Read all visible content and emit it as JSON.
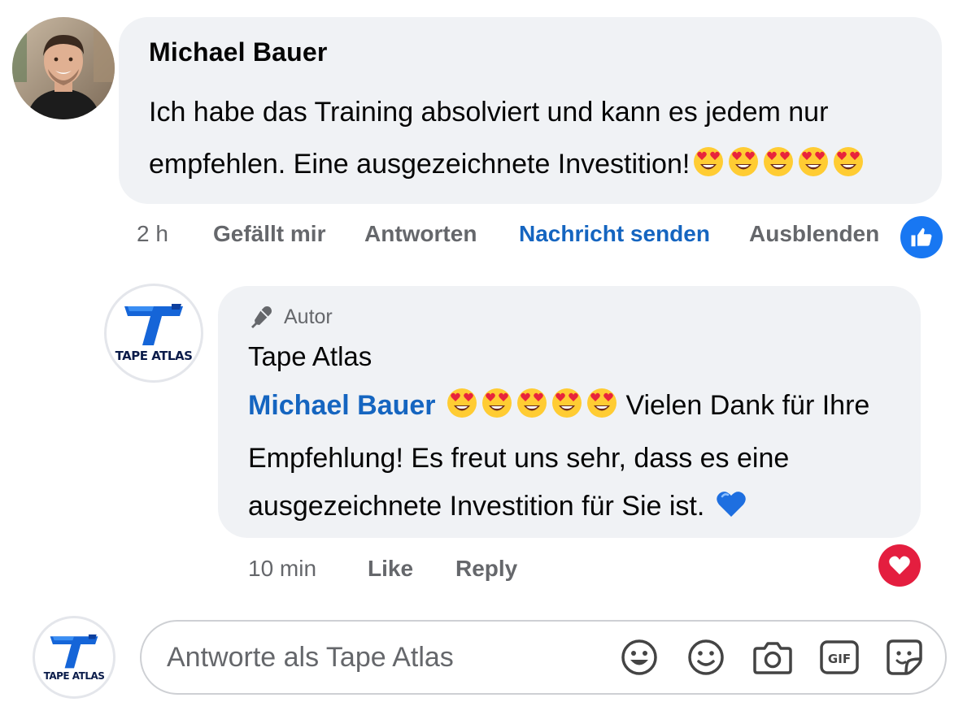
{
  "comment": {
    "author": "Michael Bauer",
    "text": "Ich habe das Training absolviert und kann es jedem nur empfehlen. Eine ausgezeichnete Investition!",
    "emoji_count": 5,
    "emoji": "heart-eyes-emoji",
    "time": "2 h",
    "actions": {
      "like": "Gefällt mir",
      "reply": "Antworten",
      "message": "Nachricht senden",
      "hide": "Ausblenden"
    },
    "reaction_icon": "thumbs-up-icon",
    "reaction_color": "#1877f2"
  },
  "reply": {
    "badge": "Autor",
    "badge_icon": "microphone-icon",
    "author": "Tape Atlas",
    "logo_text": "TAPE ATLAS",
    "mention": "Michael Bauer",
    "emoji_count": 5,
    "text": "Vielen Dank für Ihre Empfehlung! Es freut uns sehr, dass es eine ausgezeichnete Investition für Sie ist.",
    "trailing_emoji": "blue-heart-emoji",
    "time": "10 min",
    "actions": {
      "like": "Like",
      "reply": "Reply"
    },
    "reaction_icon": "heart-icon",
    "reaction_color": "#e41e3f"
  },
  "composer": {
    "placeholder": "Antworte als Tape Atlas",
    "logo_text": "TAPE ATLAS",
    "icons": [
      "avatar-sticker-icon",
      "smiley-icon",
      "camera-icon",
      "gif-icon",
      "sticker-icon"
    ]
  },
  "colors": {
    "bubble": "#f0f2f5",
    "link_blue": "#1565c0",
    "meta_gray": "#65676b"
  }
}
